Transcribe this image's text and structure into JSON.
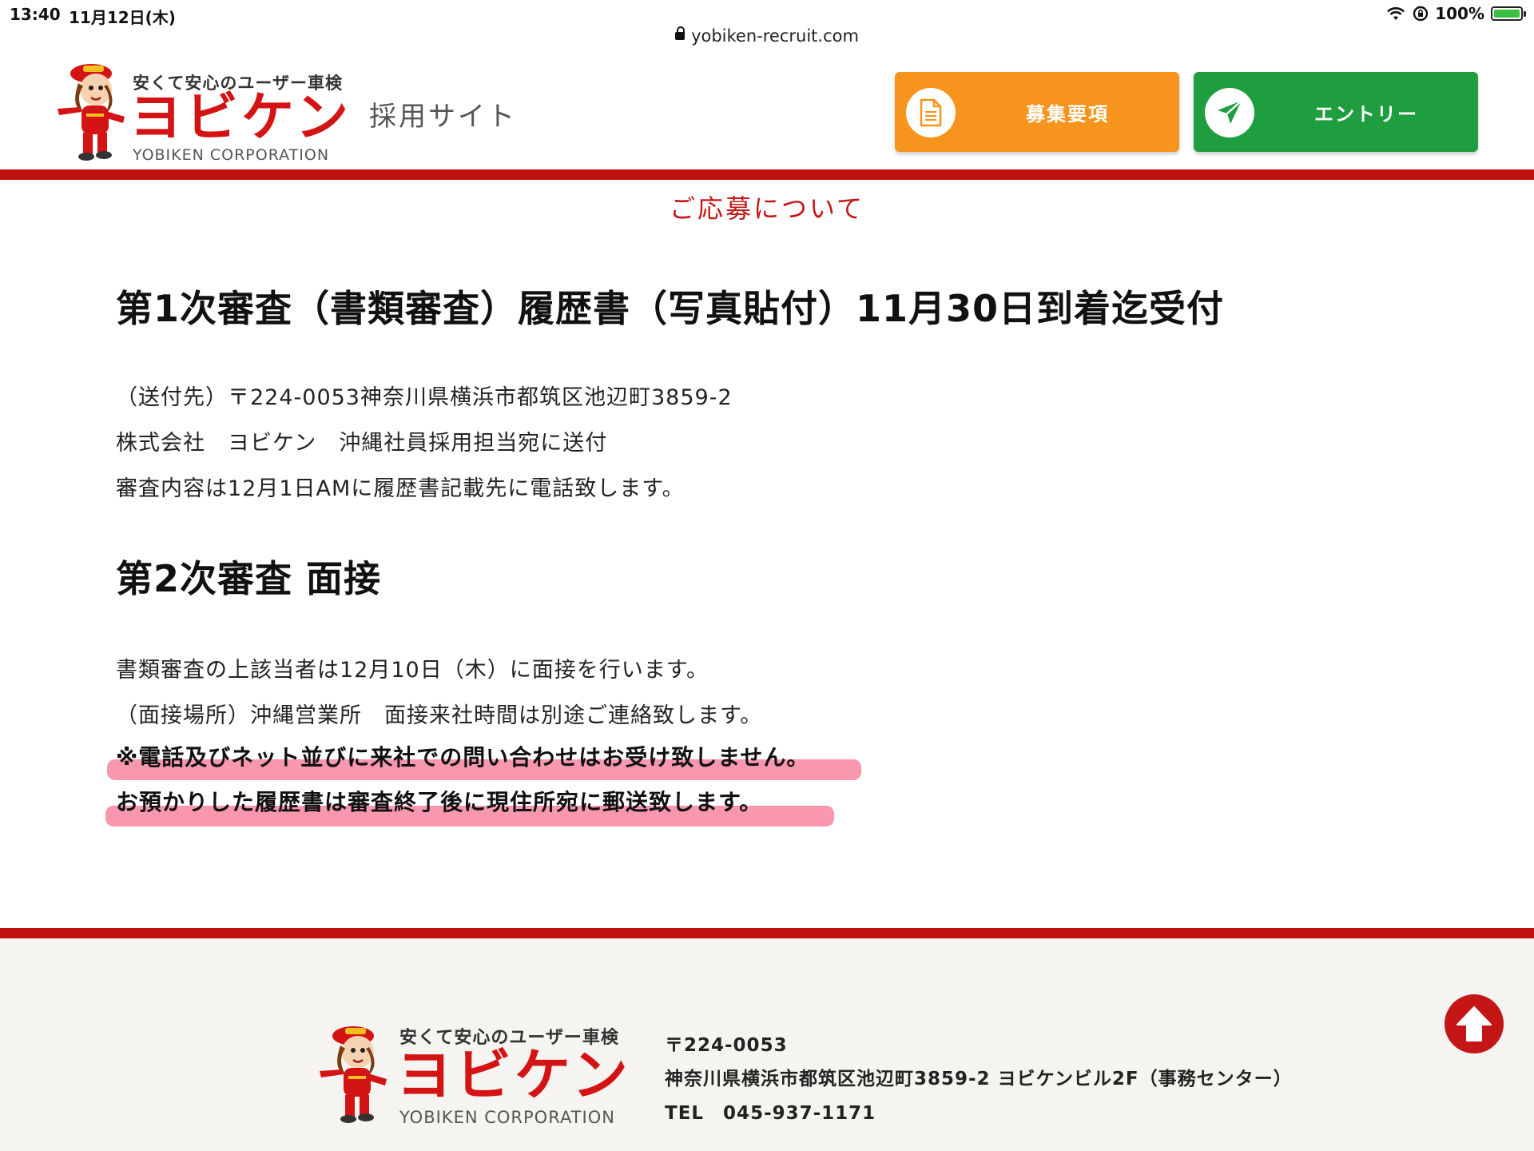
{
  "status_bar": {
    "time": "13:40",
    "date": "11月12日(木)",
    "battery": "100%",
    "battery_level": 1.0
  },
  "browser": {
    "url": "yobiken-recruit.com"
  },
  "header": {
    "logo_tagline": "安くて安心のユーザー車検",
    "logo_name": "ヨビケン",
    "logo_corp": "YOBIKEN CORPORATION",
    "site_subtitle": "採用サイト",
    "btn_requirements": "募集要項",
    "btn_entry": "エントリー"
  },
  "main": {
    "section_caption": "ご応募について",
    "stage1_heading": "第1次審査（書類審査）履歴書（写真貼付）11月30日到着迄受付",
    "stage1_lines": [
      "（送付先）〒224-0053神奈川県横浜市都筑区池辺町3859-2",
      "株式会社　ヨビケン　沖縄社員採用担当宛に送付",
      "審査内容は12月1日AMに履歴書記載先に電話致します。"
    ],
    "stage2_heading": "第2次審査 面接",
    "stage2_lines": [
      "書類審査の上該当者は12月10日（木）に面接を行います。",
      "（面接場所）沖縄営業所　面接来社時間は別途ご連絡致します。"
    ],
    "notes": [
      "※電話及びネット並びに来社での問い合わせはお受け致しません。",
      "お預かりした履歴書は審査終了後に現住所宛に郵送致します。"
    ]
  },
  "footer": {
    "logo_tagline": "安くて安心のユーザー車検",
    "logo_name": "ヨビケン",
    "logo_corp": "YOBIKEN CORPORATION",
    "postal": "〒224-0053",
    "address": "神奈川県横浜市都筑区池辺町3859-2 ヨビケンビル2F（事務センター）",
    "tel": "TEL　045-937-1171"
  },
  "colors": {
    "brand_red": "#c00f0f",
    "button_orange": "#f7941d",
    "button_green": "#1e9e3e",
    "highlight_pink": "#f4426e"
  },
  "icons": [
    "lock-icon",
    "wifi-icon",
    "rotation-lock-icon",
    "battery-icon",
    "document-icon",
    "paper-plane-icon",
    "arrow-up-icon"
  ]
}
